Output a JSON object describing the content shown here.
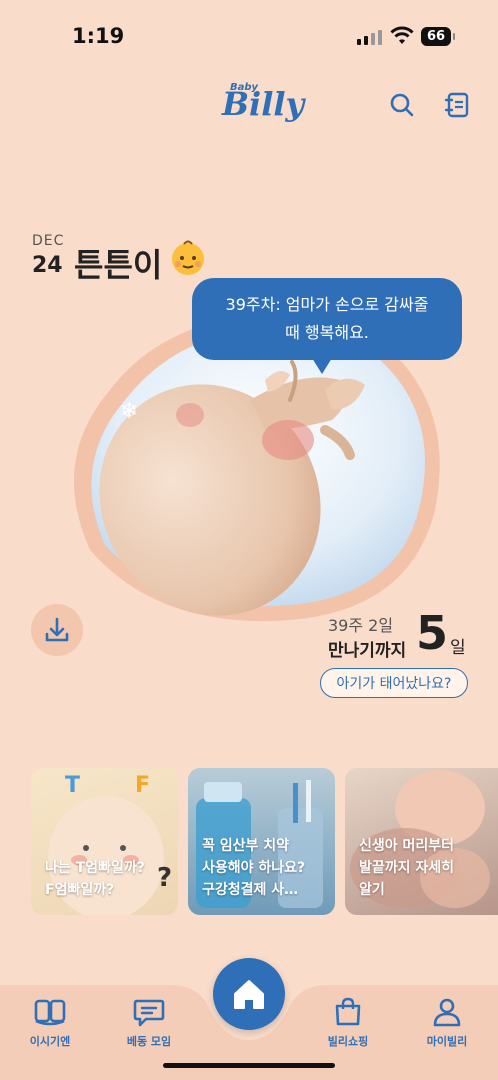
{
  "status_bar": {
    "time": "1:19",
    "battery": "66"
  },
  "header": {
    "logo_small": "Baby",
    "logo_text": "Billy",
    "search_icon": "search-icon",
    "book_icon": "notebook-icon"
  },
  "baby": {
    "month": "DEC",
    "day": "24",
    "name": "튼튼이",
    "emoji_icon": "baby-face-icon"
  },
  "speech_bubble": {
    "line1": "39주차: 엄마가 손으로 감싸줄",
    "line2": "때 행복해요."
  },
  "countdown": {
    "week": "39주 2일",
    "label": "만나기까지",
    "days": "5",
    "unit": "일"
  },
  "born_button": "아기가 태어났나요?",
  "cards": [
    {
      "line1": "나는 T엄빠일까?",
      "line2": "F엄빠일까?",
      "line3": ""
    },
    {
      "line1": "꼭 임산부 치약",
      "line2": "사용해야 하나요?",
      "line3": "구강청결제 사…"
    },
    {
      "line1": "신생아 머리부터",
      "line2": "발끝까지 자세히",
      "line3": "알기"
    }
  ],
  "card1_overlay": {
    "t": "T",
    "f": "F",
    "q": "?"
  },
  "bottom_nav": [
    {
      "label": "이시기엔",
      "icon": "book-open-icon"
    },
    {
      "label": "베동 모임",
      "icon": "chat-icon"
    },
    {
      "label": "",
      "icon": "home-icon"
    },
    {
      "label": "빌리쇼핑",
      "icon": "shopping-bag-icon"
    },
    {
      "label": "마이빌리",
      "icon": "person-icon"
    }
  ],
  "colors": {
    "background": "#f9dcca",
    "accent": "#2f6fb8",
    "nav_background": "#f4cdb8"
  }
}
